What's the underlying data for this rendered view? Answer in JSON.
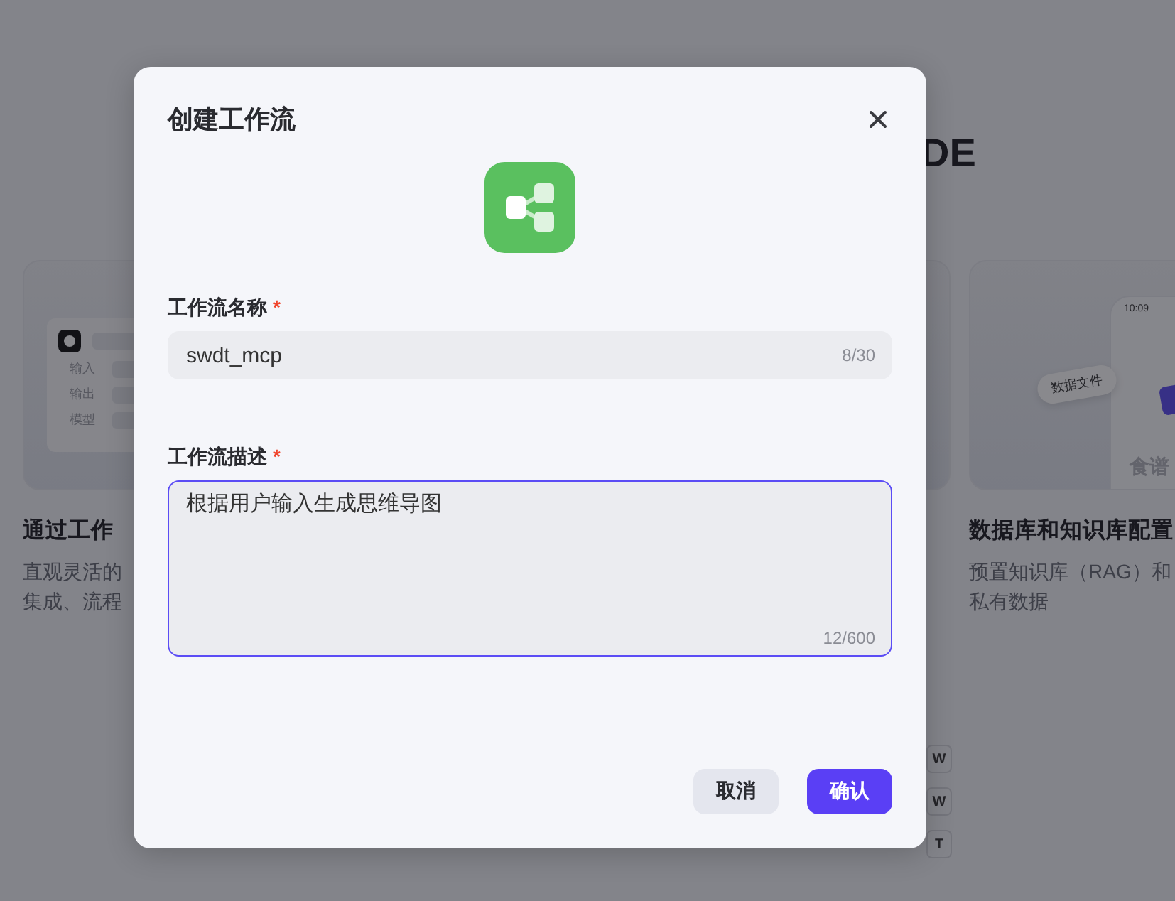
{
  "background": {
    "heading": "DE",
    "cards": [
      {
        "kind": "workflow",
        "preview_labels": [
          "输入",
          "输出",
          "模型"
        ],
        "title": "通过工作",
        "description": [
          "直观灵活的",
          "集成、流程"
        ]
      },
      {
        "kind": "blank"
      },
      {
        "kind": "phone",
        "time": "10:09",
        "chip": "数据文件",
        "caption": "食谱",
        "title": "数据库和知识库配置",
        "description": [
          "预置知识库（RAG）和",
          "私有数据"
        ]
      }
    ],
    "keys": [
      "W",
      "W",
      "T"
    ]
  },
  "dialog": {
    "title": "创建工作流",
    "fields": [
      {
        "kind": "input",
        "label": "工作流名称",
        "mark": "*",
        "value": "swdt_mcp",
        "count": "8/30",
        "focused": false
      },
      {
        "kind": "textarea",
        "label": "工作流描述",
        "mark": "*",
        "value": "根据用户输入生成思维导图",
        "count": "12/600",
        "focused": true
      }
    ],
    "buttons": [
      {
        "label": "取消",
        "primary": false
      },
      {
        "label": "确认",
        "primary": true
      }
    ]
  }
}
